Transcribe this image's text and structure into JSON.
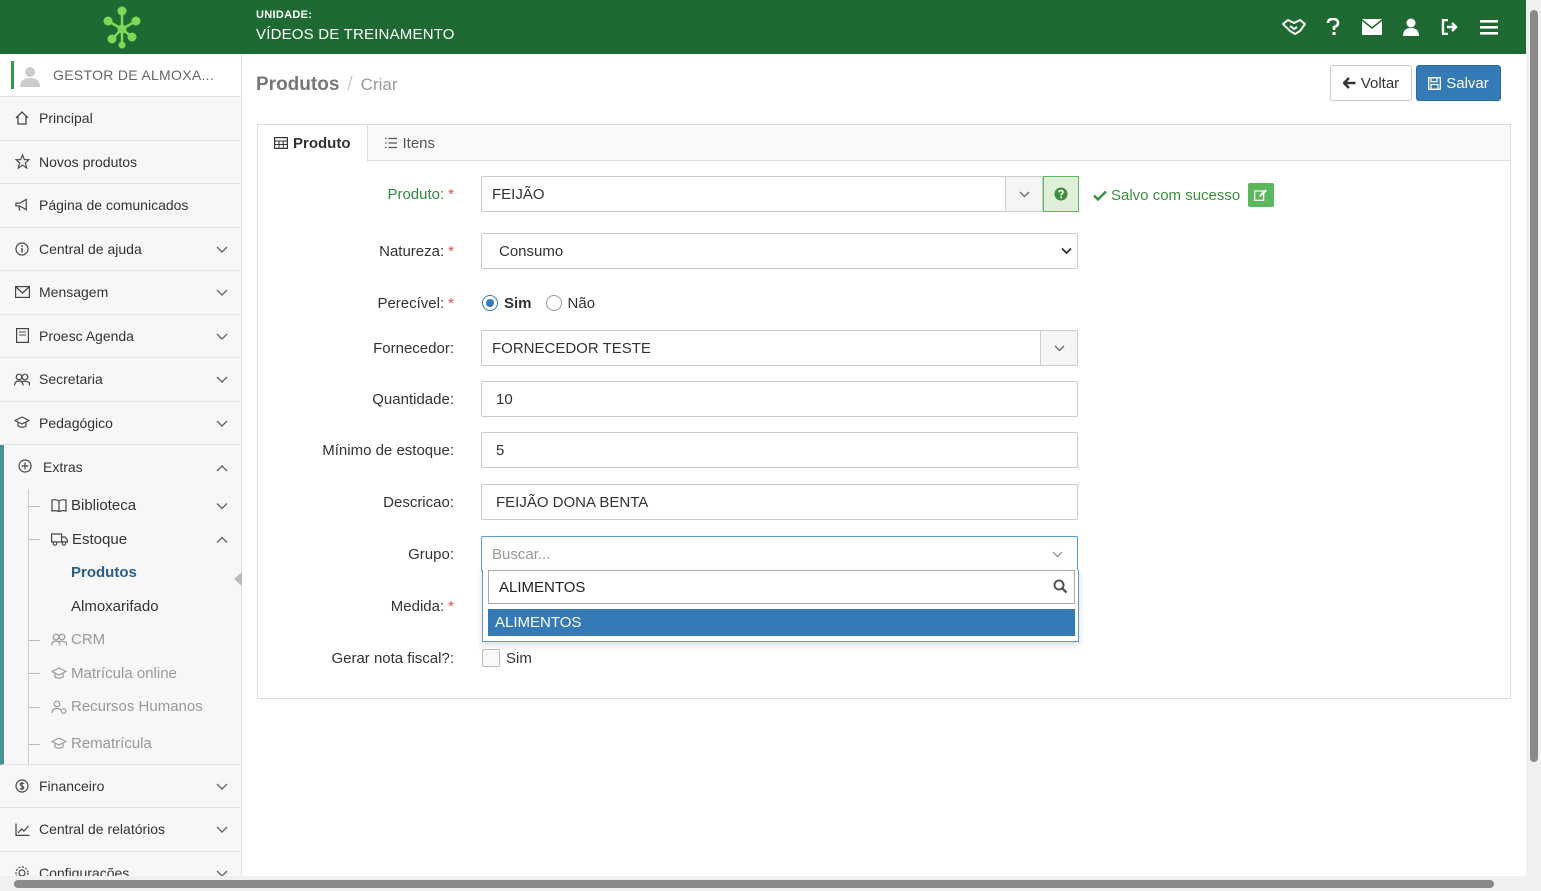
{
  "header": {
    "unit_label": "UNIDADE:",
    "unit_name": "VÍDEOS DE TREINAMENTO",
    "icons": [
      "handshake-icon",
      "help-icon",
      "mail-icon",
      "user-icon",
      "logout-icon",
      "menu-icon"
    ]
  },
  "sidebar": {
    "user": "GESTOR DE ALMOXA...",
    "items": [
      {
        "label": "Principal",
        "icon": "home-icon"
      },
      {
        "label": "Novos produtos",
        "icon": "star-icon"
      },
      {
        "label": "Página de comunicados",
        "icon": "megaphone-icon"
      },
      {
        "label": "Central de ajuda",
        "icon": "info-icon"
      },
      {
        "label": "Mensagem",
        "icon": "envelope-icon"
      },
      {
        "label": "Proesc Agenda",
        "icon": "agenda-icon"
      },
      {
        "label": "Secretaria",
        "icon": "people-icon"
      },
      {
        "label": "Pedagógico",
        "icon": "graduation-icon"
      }
    ],
    "extras": {
      "label": "Extras",
      "sub": [
        {
          "label": "Biblioteca"
        },
        {
          "label": "Estoque"
        },
        {
          "label": "CRM"
        },
        {
          "label": "Matrícula online"
        },
        {
          "label": "Recursos Humanos"
        },
        {
          "label": "Rematrícula"
        }
      ],
      "estoque_sub": [
        "Produtos",
        "Almoxarifado"
      ]
    },
    "bottom": [
      {
        "label": "Financeiro"
      },
      {
        "label": "Central de relatórios"
      },
      {
        "label": "Configurações"
      }
    ]
  },
  "page": {
    "title": "Produtos",
    "sub": "Criar",
    "back_label": "Voltar",
    "save_label": "Salvar"
  },
  "tabs": [
    "Produto",
    "Itens"
  ],
  "form": {
    "produto_label": "Produto:",
    "produto_value": "FEIJÃO",
    "success_msg": "Salvo com sucesso",
    "natureza_label": "Natureza:",
    "natureza_value": "Consumo",
    "perecivel_label": "Perecível:",
    "perecivel_yes": "Sim",
    "perecivel_no": "Não",
    "fornecedor_label": "Fornecedor:",
    "fornecedor_value": "FORNECEDOR TESTE",
    "quantidade_label": "Quantidade:",
    "quantidade_value": "10",
    "minimo_label": "Mínimo de estoque:",
    "minimo_value": "5",
    "descricao_label": "Descricao:",
    "descricao_value": "FEIJÃO DONA BENTA",
    "grupo_label": "Grupo:",
    "grupo_placeholder": "Buscar...",
    "grupo_search": "ALIMENTOS",
    "grupo_option": "ALIMENTOS",
    "medida_label": "Medida:",
    "nota_label": "Gerar nota fiscal?:",
    "nota_option": "Sim",
    "required_mark": "*"
  }
}
